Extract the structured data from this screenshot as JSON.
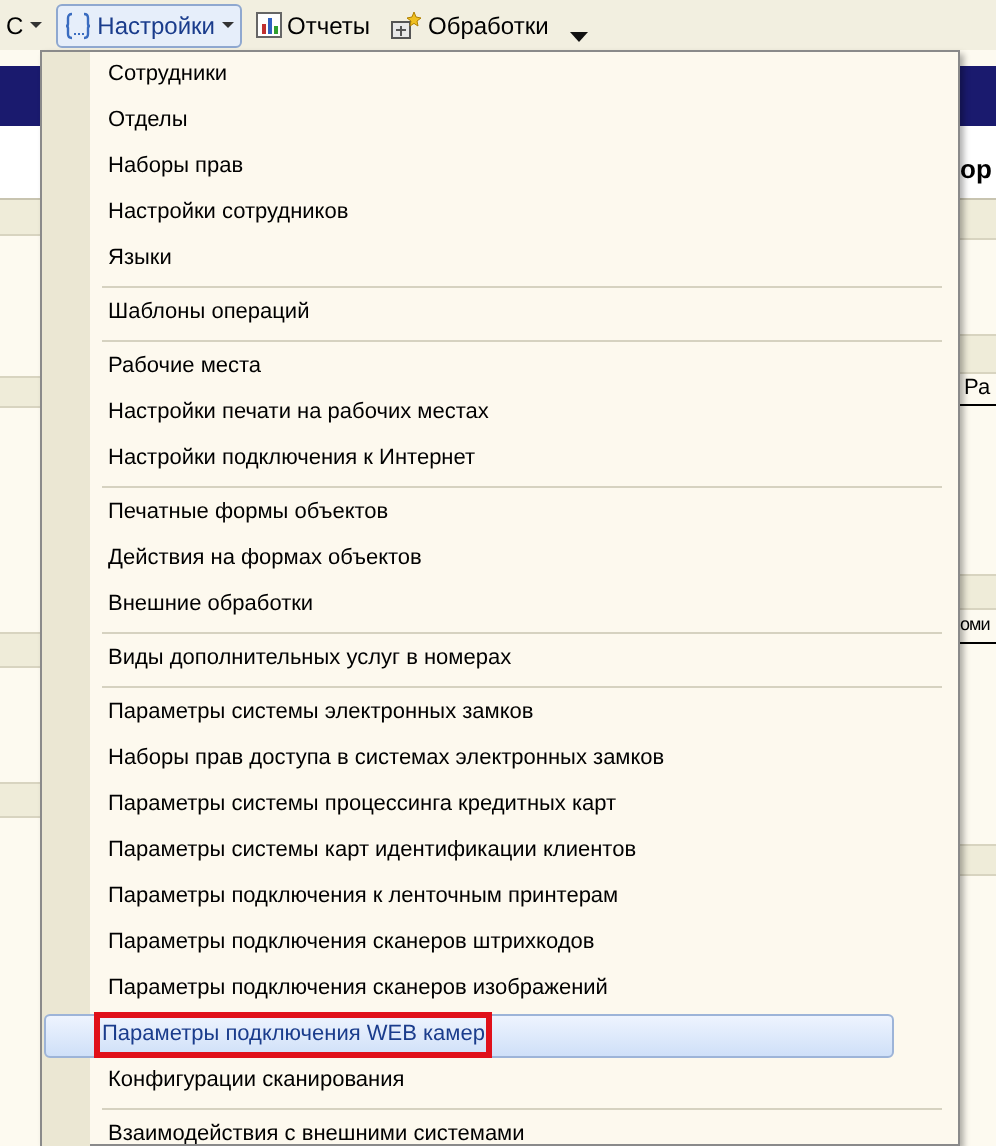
{
  "toolbar": {
    "items": [
      {
        "label": "С",
        "kind": "dropdown",
        "selected": false
      },
      {
        "label": "Настройки",
        "kind": "dropdown",
        "selected": true
      },
      {
        "label": "Отчеты",
        "kind": "plain",
        "selected": false
      },
      {
        "label": "Обработки",
        "kind": "plain",
        "selected": false
      }
    ]
  },
  "background": {
    "fragments": [
      "ор",
      "Ра",
      "оми"
    ]
  },
  "menu": {
    "groups": [
      {
        "items": [
          {
            "label": "Сотрудники",
            "selected": false
          },
          {
            "label": "Отделы",
            "selected": false
          },
          {
            "label": "Наборы прав",
            "selected": false
          },
          {
            "label": "Настройки сотрудников",
            "selected": false
          },
          {
            "label": "Языки",
            "selected": false
          }
        ]
      },
      {
        "items": [
          {
            "label": "Шаблоны операций",
            "selected": false
          }
        ]
      },
      {
        "items": [
          {
            "label": "Рабочие места",
            "selected": false
          },
          {
            "label": "Настройки печати на рабочих местах",
            "selected": false
          },
          {
            "label": "Настройки подключения к Интернет",
            "selected": false
          }
        ]
      },
      {
        "items": [
          {
            "label": "Печатные формы объектов",
            "selected": false
          },
          {
            "label": "Действия на формах объектов",
            "selected": false
          },
          {
            "label": "Внешние обработки",
            "selected": false
          }
        ]
      },
      {
        "items": [
          {
            "label": "Виды дополнительных услуг в номерах",
            "selected": false
          }
        ]
      },
      {
        "items": [
          {
            "label": "Параметры системы электронных замков",
            "selected": false
          },
          {
            "label": "Наборы прав доступа в системах электронных замков",
            "selected": false
          },
          {
            "label": "Параметры системы процессинга кредитных карт",
            "selected": false
          },
          {
            "label": "Параметры системы карт идентификации клиентов",
            "selected": false
          },
          {
            "label": "Параметры подключения к ленточным принтерам",
            "selected": false
          },
          {
            "label": "Параметры подключения сканеров штрихкодов",
            "selected": false
          },
          {
            "label": "Параметры подключения сканеров изображений",
            "selected": false
          },
          {
            "label": "Параметры подключения WEB камер",
            "selected": true
          },
          {
            "label": "Конфигурации сканирования",
            "selected": false
          }
        ]
      },
      {
        "items": [
          {
            "label": "Взаимодействия с внешними системами",
            "selected": false
          }
        ]
      }
    ]
  }
}
